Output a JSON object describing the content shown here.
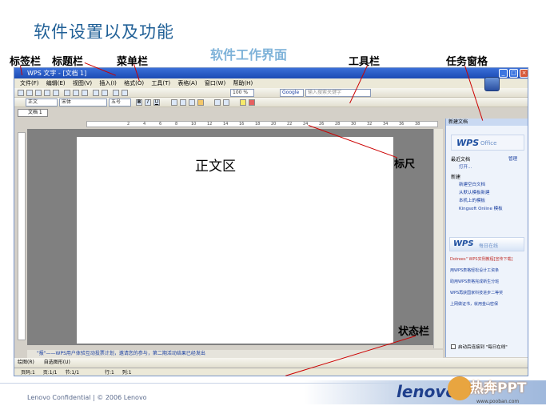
{
  "slide": {
    "title": "软件设置以及功能",
    "subtitle": "软件工作界面"
  },
  "callouts": {
    "tab_bar": "标签栏",
    "title_bar": "标题栏",
    "menu_bar": "菜单栏",
    "toolbar": "工具栏",
    "task_pane": "任务窗格",
    "ruler": "标尺",
    "body_area": "正文区",
    "status_bar": "状态栏"
  },
  "window": {
    "title": "WPS 文字 - [文档 1]",
    "controls": [
      "_",
      "□",
      "×"
    ],
    "menus": [
      "文件(F)",
      "编辑(E)",
      "视图(V)",
      "插入(I)",
      "格式(O)",
      "工具(T)",
      "表格(A)",
      "窗口(W)",
      "帮助(H)"
    ],
    "zoom": "100 %",
    "style": "正文",
    "font": "宋体",
    "size": "五号",
    "search_engine": "Google",
    "search_placeholder": "输入搜索关键字",
    "doc_tab": "文档 1",
    "ruler_ticks": [
      "2",
      "4",
      "6",
      "8",
      "10",
      "12",
      "14",
      "16",
      "18",
      "20",
      "22",
      "24",
      "26",
      "28",
      "30",
      "32",
      "34",
      "36",
      "38"
    ],
    "hint_text": "\"报\"——WPS用户体验互动投票计划，邀请您的参与，第二期活动结果已经发出",
    "draw_label": "绘图(R)",
    "autoshape_label": "自选图形(U)",
    "status": {
      "page": "页码:1",
      "pages": "页:1/1",
      "section": "节:1/1",
      "line": "行:1",
      "column": "列:1"
    }
  },
  "task_pane": {
    "header": "新建文档",
    "brand": "WPS",
    "brand_suffix": "Office",
    "recent_label": "最近文档",
    "manage": "管理",
    "open": "打开...",
    "new_label": "新建",
    "new_items": [
      "新建空白文档",
      "从默认模板新建",
      "本机上的模板",
      "Kingsoft Online 模板"
    ],
    "daily_suffix": "每日在线",
    "news": [
      "Dotrees\" WPS实例教程[宣传下载]",
      "用WPS表格轻松设计工资条",
      "助用WPS表格完成新生分班",
      "WPS再获国家科技进步二等奖",
      "上网做证书，就用金山密保"
    ],
    "startup_check": "启动后连接到 \"每日在线\""
  },
  "footer": {
    "confidential": "Lenovo Confidential | © 2006 Lenovo",
    "brand": "lenovo",
    "watermark": "热奔PPT",
    "watermark_url": "www.pooban.com"
  }
}
